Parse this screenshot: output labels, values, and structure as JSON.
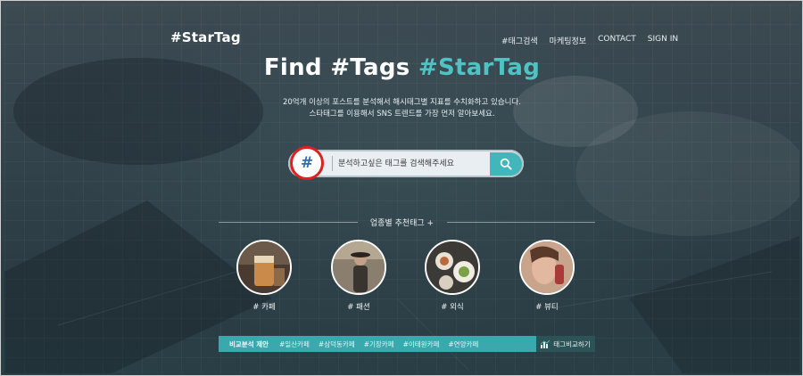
{
  "header": {
    "logo": "#StarTag",
    "nav": [
      "#태그검색",
      "마케팅정보",
      "CONTACT",
      "SIGN IN"
    ]
  },
  "hero": {
    "title_white": "Find #Tags",
    "title_teal": "#StarTag",
    "sub1": "20억개 이상의 포스트를 분석해서 해시태그별 지표를 수치화하고 있습니다.",
    "sub2": "스타태그를 이용해서 SNS 트렌드를 가장 먼저 알아보세요."
  },
  "search": {
    "hash": "#",
    "placeholder": "분석하고싶은 태그를 검색해주세요"
  },
  "recommend": {
    "label": "업종별 추천태그 +",
    "categories": [
      "# 카페",
      "# 패션",
      "# 외식",
      "# 뷰티"
    ]
  },
  "compare": {
    "title": "비교분석 제안",
    "tags": [
      "#일산카페",
      "#삼덕동카페",
      "#기장카페",
      "#이태원카페",
      "#연양카페"
    ],
    "button": "태그비교하기"
  },
  "colors": {
    "accent": "#4fc3c4",
    "search_button": "#43b6bb",
    "highlight_ring": "#e02020",
    "compare_bar": "#3aa9ae"
  }
}
